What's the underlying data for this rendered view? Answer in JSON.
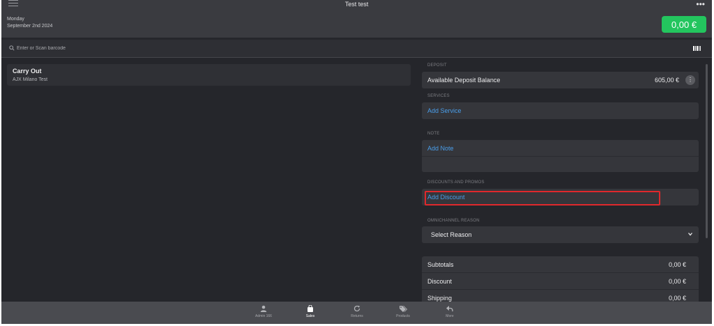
{
  "header": {
    "title": "Test test",
    "day": "Monday",
    "date": "September 2nd 2024",
    "total": "0,00 €"
  },
  "search": {
    "placeholder": "Enter or Scan barcode"
  },
  "order": {
    "title": "Carry Out",
    "subtitle": "AJX Milano Test"
  },
  "panel": {
    "deposit_label": "DEPOSIT",
    "deposit_row_label": "Available Deposit Balance",
    "deposit_value": "605,00 €",
    "services_label": "SERVICES",
    "add_service": "Add Service",
    "note_label": "NOTE",
    "add_note": "Add Note",
    "discounts_label": "DISCOUNTS AND PROMOS",
    "add_discount": "Add Discount",
    "omni_label": "OMNICHANNEL REASON",
    "select_reason": "Select Reason"
  },
  "totals": [
    {
      "label": "Subtotals",
      "value": "0,00 €"
    },
    {
      "label": "Discount",
      "value": "0,00 €"
    },
    {
      "label": "Shipping",
      "value": "0,00 €"
    }
  ],
  "nav": [
    {
      "label": "Admin 166",
      "icon": "user-icon",
      "active": false
    },
    {
      "label": "Sales",
      "icon": "shopping-bag-icon",
      "active": true
    },
    {
      "label": "Returns",
      "icon": "refresh-icon",
      "active": false
    },
    {
      "label": "Products",
      "icon": "tags-icon",
      "active": false
    },
    {
      "label": "More",
      "icon": "reply-icon",
      "active": false
    }
  ],
  "colors": {
    "accent_green": "#23c55e",
    "link_blue": "#4a9eea",
    "highlight_red": "#e0282c"
  }
}
